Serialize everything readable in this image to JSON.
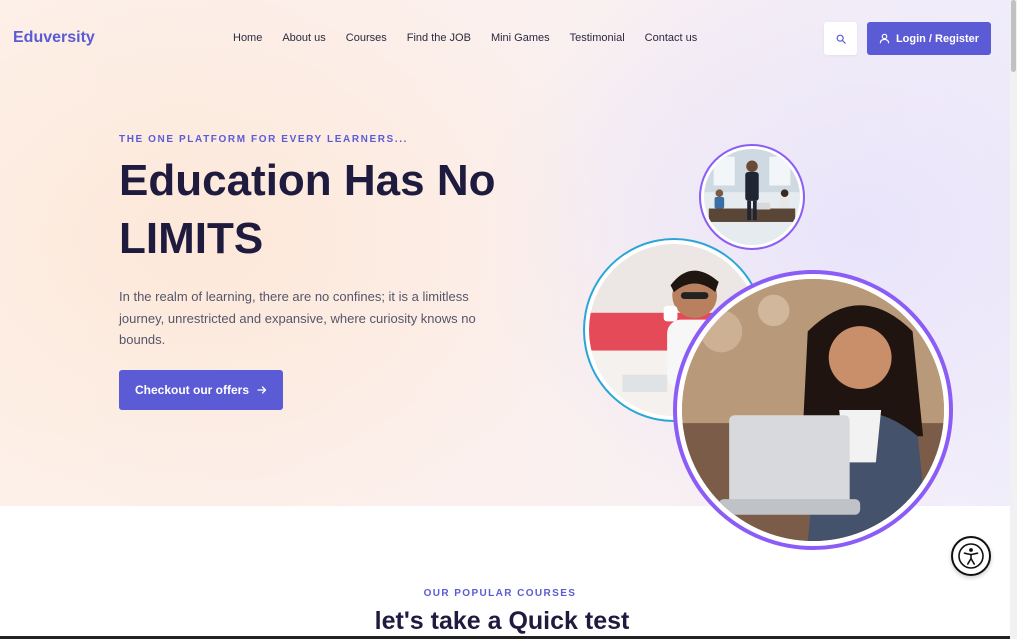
{
  "header": {
    "logo": "Eduversity",
    "nav": [
      "Home",
      "About us",
      "Courses",
      "Find the JOB",
      "Mini Games",
      "Testimonial",
      "Contact us"
    ],
    "login_label": "Login / Register",
    "search_icon": "search-icon",
    "user_icon": "user-icon"
  },
  "hero": {
    "eyebrow": "THE ONE PLATFORM FOR EVERY LEARNERS...",
    "title_line1": "Education Has No",
    "title_line2": "LIMITS",
    "description": "In the realm of learning, there are no confines; it is a limitless journey, unrestricted and expansive, where curiosity knows no bounds.",
    "cta_label": "Checkout our offers",
    "cta_icon": "arrow-right-icon"
  },
  "section": {
    "eyebrow": "OUR POPULAR COURSES",
    "title": "let's take a Quick test"
  },
  "colors": {
    "accent": "#5b5bd6",
    "ring_purple": "#8b5cf6",
    "ring_blue": "#2aa6d6",
    "heading": "#1e1b3f"
  },
  "accessibility_icon": "accessibility-icon"
}
